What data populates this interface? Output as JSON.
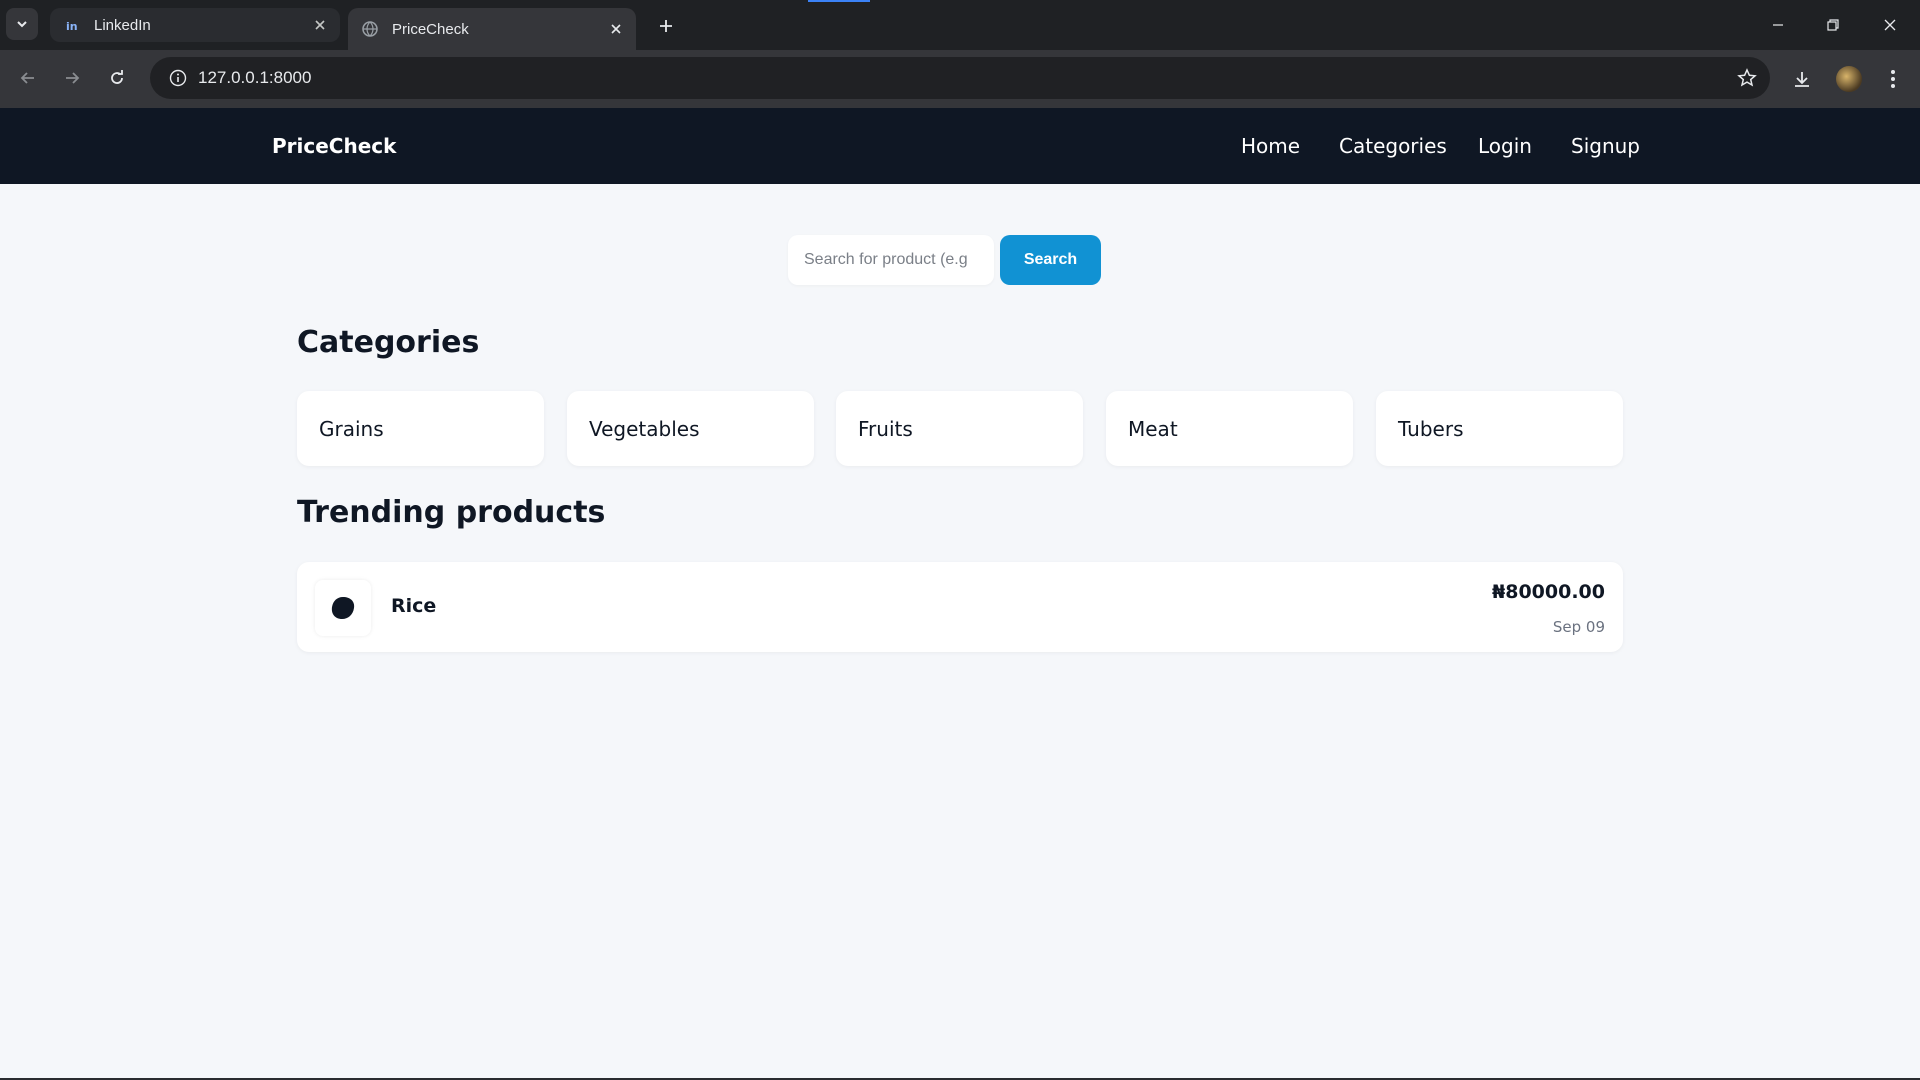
{
  "browser": {
    "tabs": [
      {
        "title": "LinkedIn",
        "icon": "linkedin-icon",
        "active": false
      },
      {
        "title": "PriceCheck",
        "icon": "globe-icon",
        "active": true
      }
    ],
    "url": "127.0.0.1:8000"
  },
  "site": {
    "brand": "PriceCheck",
    "nav": {
      "home": "Home",
      "categories": "Categories",
      "login": "Login",
      "signup": "Signup"
    }
  },
  "search": {
    "placeholder": "Search for product (e.g",
    "button": "Search"
  },
  "categories": {
    "title": "Categories",
    "items": [
      "Grains",
      "Vegetables",
      "Fruits",
      "Meat",
      "Tubers"
    ]
  },
  "trending": {
    "title": "Trending products",
    "products": [
      {
        "name": "Rice",
        "price": "₦80000.00",
        "date": "Sep 09"
      }
    ]
  },
  "colors": {
    "header_bg": "#0f1724",
    "accent": "#1192d3",
    "page_bg": "#f5f7fa"
  }
}
